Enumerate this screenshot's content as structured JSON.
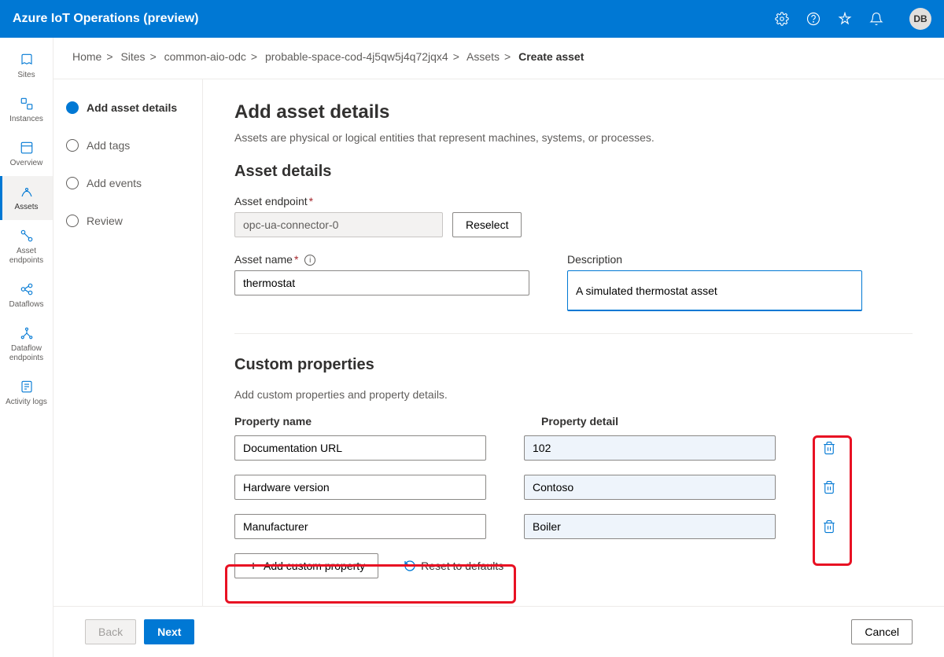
{
  "app_title": "Azure IoT Operations (preview)",
  "user_initials": "DB",
  "breadcrumb": {
    "items": [
      "Home",
      "Sites",
      "common-aio-odc",
      "probable-space-cod-4j5qw5j4q72jqx4",
      "Assets"
    ],
    "current": "Create asset"
  },
  "leftnav": {
    "sites": "Sites",
    "instances": "Instances",
    "overview": "Overview",
    "assets": "Assets",
    "asset_endpoints": "Asset endpoints",
    "dataflows": "Dataflows",
    "dataflow_endpoints": "Dataflow endpoints",
    "activity_logs": "Activity logs"
  },
  "steps": {
    "add_details": "Add asset details",
    "add_tags": "Add tags",
    "add_events": "Add events",
    "review": "Review"
  },
  "page": {
    "title": "Add asset details",
    "description": "Assets are physical or logical entities that represent machines, systems, or processes."
  },
  "asset_details": {
    "heading": "Asset details",
    "endpoint_label": "Asset endpoint",
    "endpoint_value": "opc-ua-connector-0",
    "reselect": "Reselect",
    "name_label": "Asset name",
    "name_value": "thermostat",
    "description_label": "Description",
    "description_value": "A simulated thermostat asset"
  },
  "custom_properties": {
    "heading": "Custom properties",
    "description": "Add custom properties and property details.",
    "name_header": "Property name",
    "detail_header": "Property detail",
    "rows": [
      {
        "name": "Documentation URL",
        "detail": "102"
      },
      {
        "name": "Hardware version",
        "detail": "Contoso"
      },
      {
        "name": "Manufacturer",
        "detail": "Boiler"
      }
    ],
    "add_button": "Add custom property",
    "reset_button": "Reset to defaults"
  },
  "footer": {
    "back": "Back",
    "next": "Next",
    "cancel": "Cancel"
  }
}
